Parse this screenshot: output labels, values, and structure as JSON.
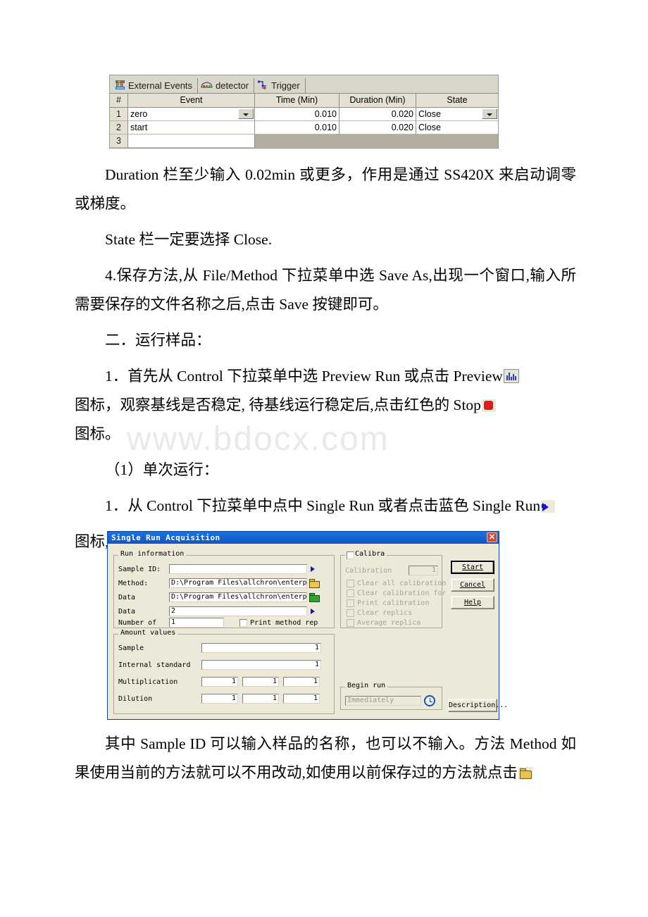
{
  "watermark": "www.bdocx.com",
  "events_window": {
    "tabs": [
      {
        "label": "External Events",
        "icon": "instrument-icon",
        "active": true
      },
      {
        "label": "detector",
        "icon": "detector-icon",
        "active": false
      },
      {
        "label": "Trigger",
        "icon": "trigger-icon",
        "active": false
      }
    ],
    "columns": [
      "#",
      "Event",
      "Time (Min)",
      "Duration (Min)",
      "State"
    ],
    "rows": [
      {
        "num": "1",
        "event": "zero",
        "time": "0.010",
        "duration": "0.020",
        "state": "Close"
      },
      {
        "num": "2",
        "event": "start",
        "time": "0.010",
        "duration": "0.020",
        "state": "Close"
      },
      {
        "num": "3",
        "event": "",
        "time": "",
        "duration": "",
        "state": ""
      }
    ]
  },
  "paragraphs": {
    "p1": "Duration 栏至少输入 0.02min 或更多，作用是通过 SS420X 来启动调零或梯度。",
    "p2": "State 栏一定要选择 Close.",
    "p3": "4.保存方法,从 File/Method 下拉菜单中选 Save As,出现一个窗口,输入所需要保存的文件名称之后,点击 Save 按键即可。",
    "p4": "二．运行样品：",
    "p5a": "1．首先从 Control 下拉菜单中选 Preview Run 或点击 Preview",
    "p5b": "图标，观察基线是否稳定, 待基线运行稳定后,点击红色的 Stop",
    "p5c": "图标。",
    "p6": "（1）单次运行：",
    "p7a": "1．从 Control 下拉菜单中点中 Single Run 或者点击蓝色 Single Run",
    "p7b": "图标,就会出现一个窗口。",
    "p8a": "其中 Sample ID 可以输入样品的名称，也可以不输入。方法 Method 如果使用当前的方法就可以不用改动,如使用以前保存过的方法就点击"
  },
  "dialog": {
    "title": "Single Run Acquisition",
    "close_label": "✕",
    "run_information": {
      "legend": "Run information",
      "fields": [
        {
          "label": "Sample ID:",
          "value": "",
          "button": "arrow"
        },
        {
          "label": "Method:",
          "value": "D:\\Program Files\\allchron\\enterprise\\P",
          "button": "folder-yellow"
        },
        {
          "label": "Data",
          "value": "D:\\Program Files\\allchron\\enterprise\\P",
          "button": "folder-green"
        },
        {
          "label": "Data",
          "value": "2",
          "button": "arrow"
        }
      ],
      "number_of_label": "Number of",
      "number_of_value": "1",
      "print_method_label": "Print method rep"
    },
    "amount_values": {
      "legend": "Amount values",
      "rows": [
        {
          "label": "Sample",
          "values": [
            "1"
          ]
        },
        {
          "label": "Internal standard",
          "values": [
            "1"
          ]
        },
        {
          "label": "Multiplication",
          "values": [
            "1",
            "1",
            "1"
          ]
        },
        {
          "label": "Dilution",
          "values": [
            "1",
            "1",
            "1"
          ]
        }
      ]
    },
    "calibration": {
      "legend": "Calibra",
      "level_label": "Calibration",
      "level_value": "1",
      "options": [
        "Clear all calibration",
        "Clear calibration for",
        "Print calibration",
        "Clear replics",
        "Average replica"
      ]
    },
    "begin_run": {
      "legend": "Begin run",
      "value": "Immediately"
    },
    "buttons": {
      "start": "Start",
      "cancel": "Cancel",
      "help": "Help",
      "description": "Description..."
    }
  }
}
